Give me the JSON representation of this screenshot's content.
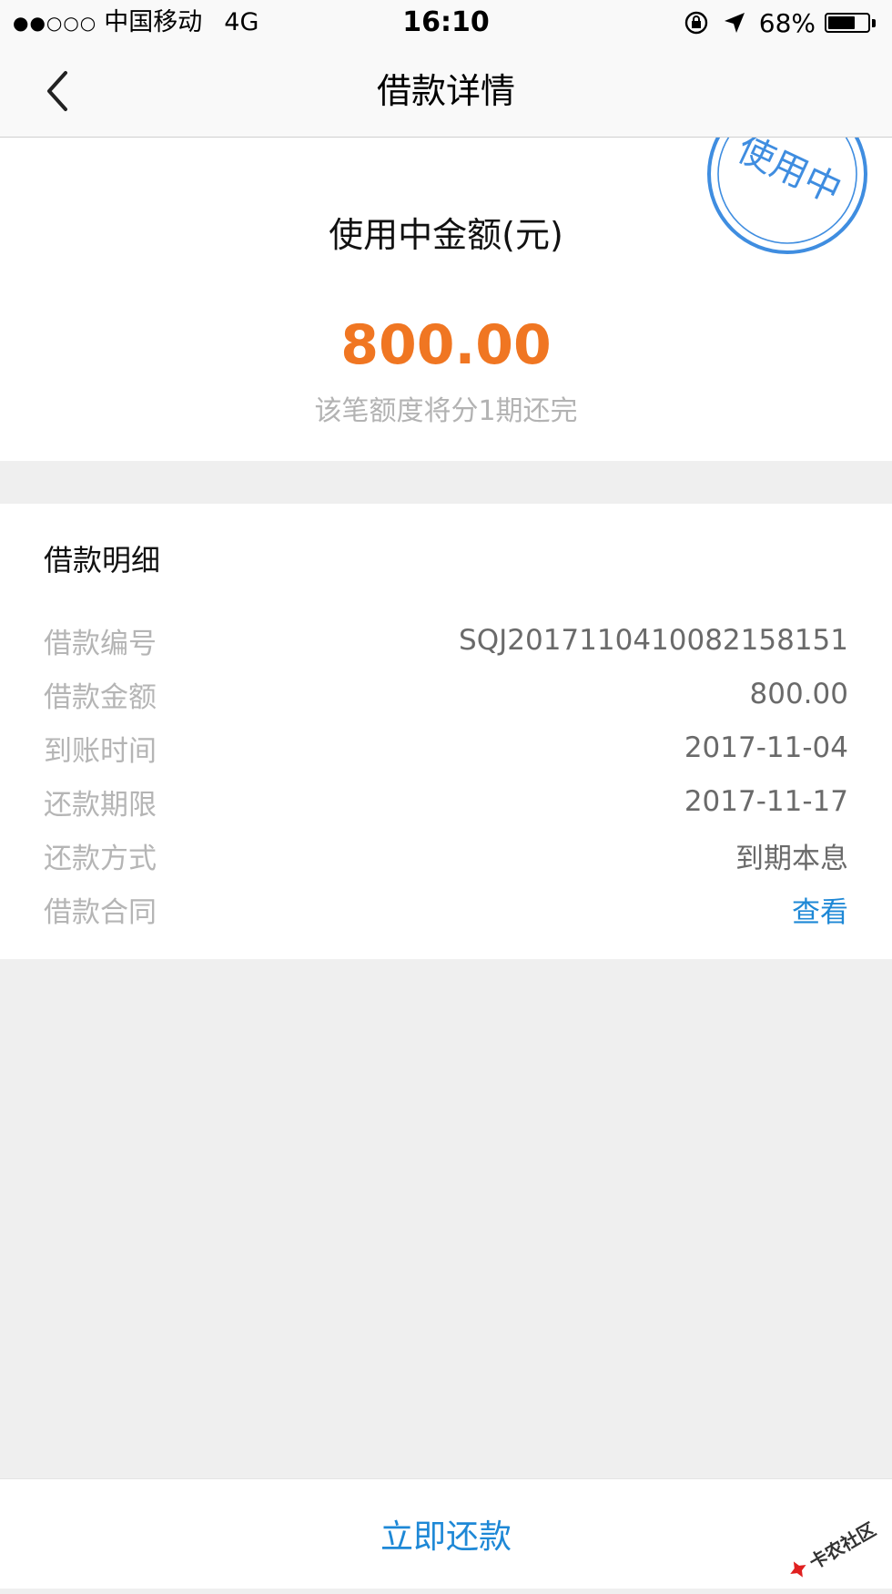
{
  "status_bar": {
    "signal": "●●○○○",
    "carrier": "中国移动",
    "network": "4G",
    "time": "16:10",
    "battery_percent": "68%",
    "battery_level": 0.68
  },
  "nav": {
    "title": "借款详情"
  },
  "amount": {
    "label": "使用中金额(元)",
    "value": "800.00",
    "note": "该笔额度将分1期还完",
    "stamp_text": "使用中",
    "accent_color": "#f07622",
    "stamp_color": "#3f8de0"
  },
  "details": {
    "title": "借款明细",
    "rows": [
      {
        "label": "借款编号",
        "value": "SQJ20171104100821581​51"
      },
      {
        "label": "借款金额",
        "value": "800.00"
      },
      {
        "label": "到账时间",
        "value": "2017-11-04"
      },
      {
        "label": "还款期限",
        "value": "2017-11-17"
      },
      {
        "label": "还款方式",
        "value": "到期本息"
      },
      {
        "label": "借款合同",
        "value": "查看"
      }
    ],
    "link_color": "#1e88d6"
  },
  "footer": {
    "repay_label": "立即还款",
    "watermark": "卡农社区"
  }
}
